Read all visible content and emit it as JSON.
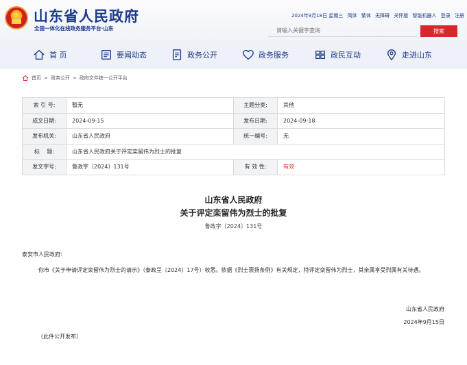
{
  "header": {
    "site_title": "山东省人民政府",
    "site_subtitle": "全国一体化在线政务服务平台·山东",
    "top_links": [
      "2024年9月18日 星期三",
      "简体",
      "繁体",
      "无障碍",
      "关怀版",
      "智能机器人",
      "登录",
      "注册"
    ],
    "search_placeholder": "请输入关键字查询",
    "search_button": "搜索"
  },
  "nav": {
    "items": [
      {
        "label": "首 页",
        "icon": "home-icon"
      },
      {
        "label": "要闻动态",
        "icon": "news-icon"
      },
      {
        "label": "政务公开",
        "icon": "document-icon"
      },
      {
        "label": "政务服务",
        "icon": "heart-icon"
      },
      {
        "label": "政民互动",
        "icon": "interaction-icon"
      },
      {
        "label": "走进山东",
        "icon": "location-icon"
      }
    ]
  },
  "breadcrumb": {
    "home": "首页",
    "sep": ">",
    "level1": "政务公开",
    "level2": "政府文件统一公开平台"
  },
  "meta": {
    "index_label": "索 引 号:",
    "index_value": "暂无",
    "category_label": "主题分类:",
    "category_value": "其他",
    "created_label": "成文日期:",
    "created_value": "2024-09-15",
    "published_label": "发布日期:",
    "published_value": "2024-09-18",
    "issuer_label": "发布机关:",
    "issuer_value": "山东省人民政府",
    "unified_label": "统一编号:",
    "unified_value": "无",
    "title_label": "标　 题:",
    "title_value": "山东省人民政府关于评定栾留伟为烈士的批复",
    "docno_label": "发文字号:",
    "docno_value": "鲁政字〔2024〕131号",
    "validity_label": "有 效 性:",
    "validity_value": "有效"
  },
  "document": {
    "org": "山东省人民政府",
    "title": "关于评定栾留伟为烈士的批复",
    "number": "鲁政字〔2024〕131号",
    "addressee": "泰安市人民政府:",
    "body": "你市《关于申请评定栾留伟为烈士的请示》（泰政呈〔2024〕17号）收悉。依据《烈士褒扬条例》有关规定，特评定栾留伟为烈士，其亲属享受烈属有关待遇。",
    "sign_org": "山东省人民政府",
    "sign_date": "2024年9月15日",
    "note": "（此件公开发布）"
  },
  "colors": {
    "brand_blue": "#1a3a8c",
    "accent_red": "#d7262c"
  }
}
